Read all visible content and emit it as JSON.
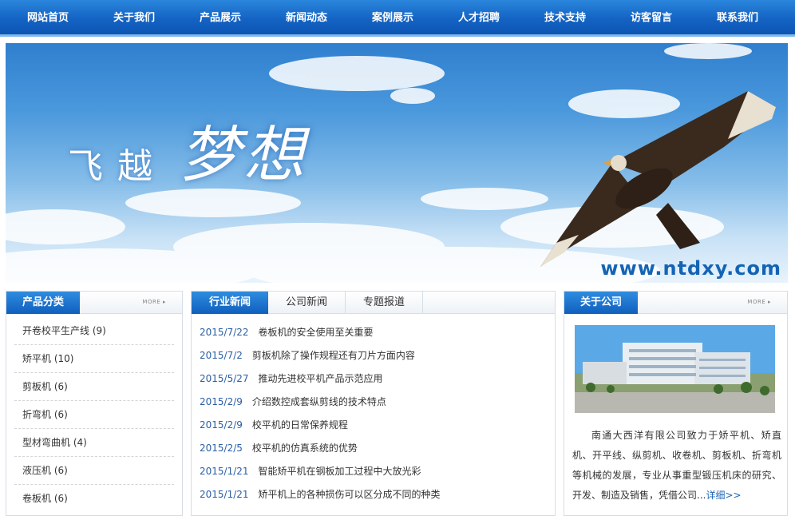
{
  "nav": {
    "items": [
      "网站首页",
      "关于我们",
      "产品展示",
      "新闻动态",
      "案例展示",
      "人才招聘",
      "技术支持",
      "访客留言",
      "联系我们"
    ]
  },
  "banner": {
    "slogan_left": "飞越",
    "slogan_right": "梦想",
    "url": "www.ntdxy.com"
  },
  "categories": {
    "title": "产品分类",
    "more": "MORE ▸",
    "items": [
      "开卷校平生产线 (9)",
      "矫平机 (10)",
      "剪板机 (6)",
      "折弯机 (6)",
      "型材弯曲机 (4)",
      "液压机 (6)",
      "卷板机 (6)"
    ]
  },
  "news": {
    "tabs": [
      "行业新闻",
      "公司新闻",
      "专题报道"
    ],
    "items": [
      {
        "date": "2015/7/22",
        "title": "卷板机的安全使用至关重要"
      },
      {
        "date": "2015/7/2",
        "title": "剪板机除了操作规程还有刀片方面内容"
      },
      {
        "date": "2015/5/27",
        "title": "推动先进校平机产品示范应用"
      },
      {
        "date": "2015/2/9",
        "title": "介绍数控成套纵剪线的技术特点"
      },
      {
        "date": "2015/2/9",
        "title": "校平机的日常保养规程"
      },
      {
        "date": "2015/2/5",
        "title": "校平机的仿真系统的优势"
      },
      {
        "date": "2015/1/21",
        "title": "智能矫平机在钢板加工过程中大放光彩"
      },
      {
        "date": "2015/1/21",
        "title": "矫平机上的各种损伤可以区分成不同的种类"
      }
    ]
  },
  "about": {
    "title": "关于公司",
    "more": "MORE ▸",
    "text": "南通大西洋有限公司致力于矫平机、矫直机、开平线、纵剪机、收卷机、剪板机、折弯机等机械的发展，专业从事重型锻压机床的研究、开发、制造及销售，凭借公司...",
    "detail": "详细>>"
  },
  "colors": {
    "nav_blue": "#1463c4",
    "title_blue": "#0f5fbd",
    "date_blue": "#2a5fa5"
  }
}
